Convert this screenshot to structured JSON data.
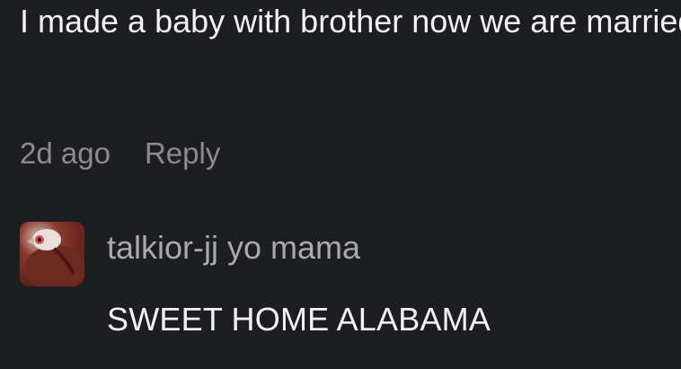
{
  "comment": {
    "text": "I made a baby with brother now we are married",
    "timestamp": "2d ago",
    "reply_label": "Reply"
  },
  "reply": {
    "author": "talkior-jj yo mama",
    "text": "SWEET HOME ALABAMA",
    "avatar_icon": "bird-avatar-icon"
  },
  "colors": {
    "background": "#1d1e22",
    "primary_text": "#f2f2f2",
    "secondary_text": "#8b8b90"
  }
}
